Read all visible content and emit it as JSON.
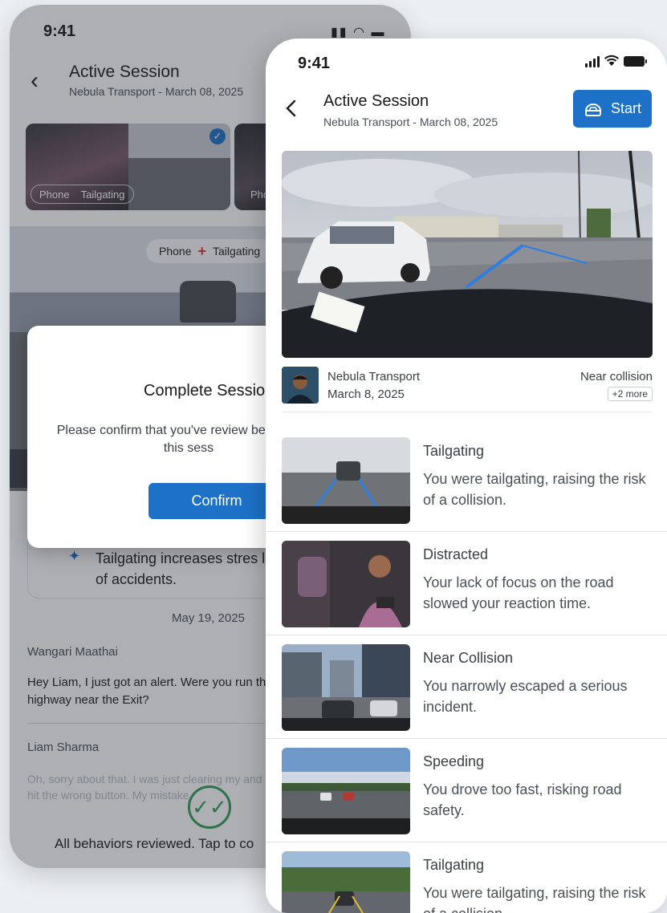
{
  "back_screen": {
    "status_time": "9:41",
    "title": "Active Session",
    "subtitle": "Nebula Transport - March 08, 2025",
    "thumb_tags": [
      "Phone",
      "Tailgating"
    ],
    "thumb2_tag": "Pho",
    "video_pill_left": "Phone",
    "video_pill_right": "Tailgating",
    "tip_text": "Tailgating increases stres likelihood of accidents.",
    "date_divider": "May 19, 2025",
    "messages": [
      {
        "author": "Wangari Maathai",
        "text": "Hey Liam, I just got an alert. Were you run the highway near the Exit?"
      },
      {
        "author": "Liam Sharma",
        "text": "Oh, sorry about that. I was just clearing my and hit the wrong button. My mistake."
      }
    ],
    "footer_text": "All behaviors reviewed. Tap to co",
    "dialog": {
      "title": "Complete Sessio",
      "body": "Please confirm that you've review behaviors in this sess",
      "confirm_label": "Confirm"
    }
  },
  "front_screen": {
    "status_time": "9:41",
    "title": "Active Session",
    "subtitle": "Nebula Transport - March 08, 2025",
    "start_label": "Start",
    "session_info": {
      "company": "Nebula Transport",
      "date": "March 8, 2025",
      "event": "Near collision",
      "more": "+2 more"
    },
    "behaviors": [
      {
        "title": "Tailgating",
        "description": "You were tailgating, raising the risk of a collision.",
        "scene": "highway"
      },
      {
        "title": "Distracted",
        "description": "Your lack of focus on the road slowed your reaction time.",
        "scene": "cabin"
      },
      {
        "title": "Near Collision",
        "description": "You narrowly escaped a serious incident.",
        "scene": "city"
      },
      {
        "title": "Speeding",
        "description": "You drove too fast, risking road safety.",
        "scene": "open-road"
      },
      {
        "title": "Tailgating",
        "description": "You were tailgating, raising the risk of a collision.",
        "scene": "trees"
      }
    ]
  },
  "colors": {
    "primary": "#1d72c7",
    "success": "#2f9d57",
    "alert": "#e0302f",
    "lane": "#2f7ee0"
  },
  "icons": [
    "chevron-left-icon",
    "steering-wheel-icon",
    "signal-icon",
    "wifi-icon",
    "battery-icon",
    "sparkle-icon",
    "double-check-icon",
    "checkmark-icon",
    "plus-icon"
  ]
}
